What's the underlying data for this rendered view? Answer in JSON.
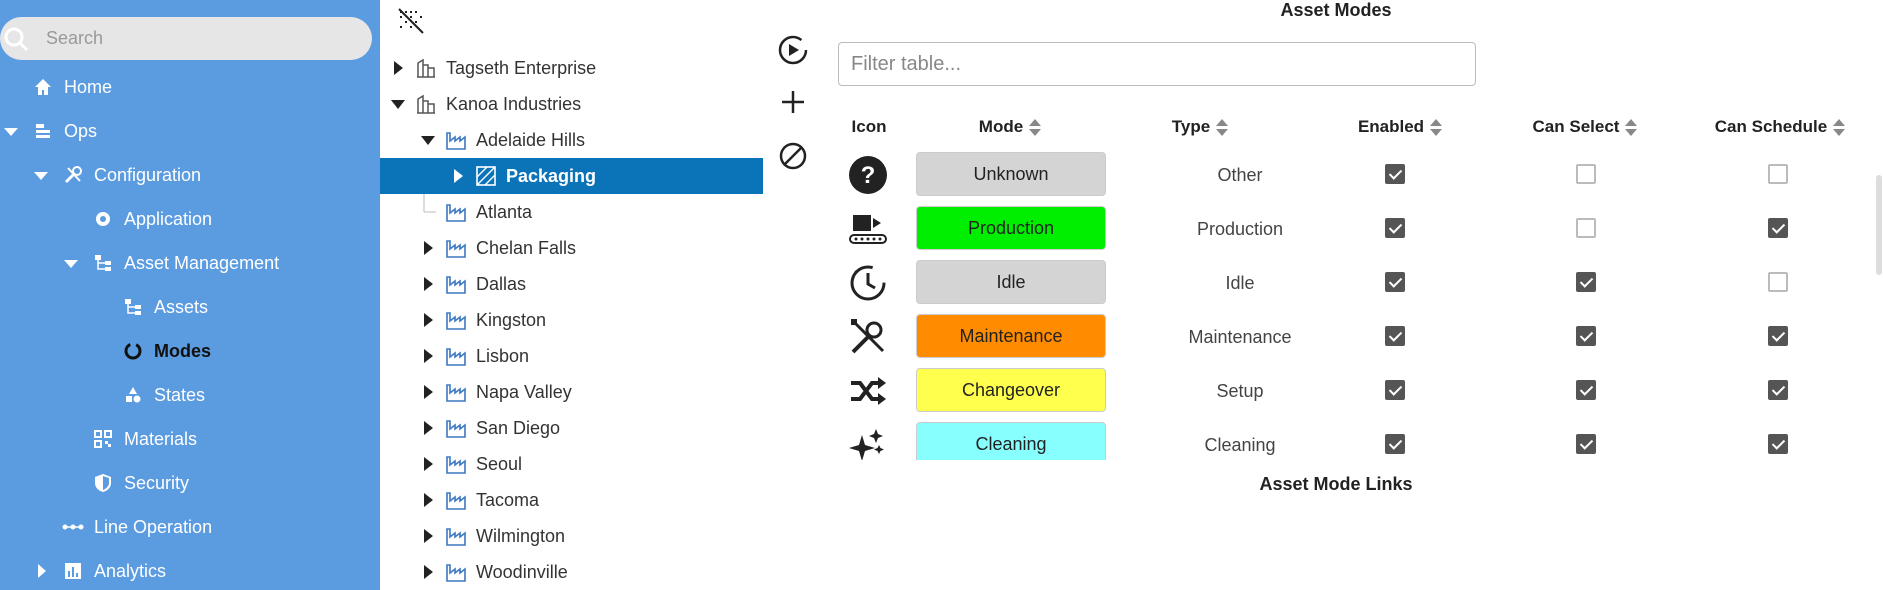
{
  "sidebar": {
    "search_placeholder": "Search",
    "items": [
      {
        "label": "Home",
        "icon": "home-icon"
      },
      {
        "label": "Ops",
        "icon": "ops-icon"
      },
      {
        "label": "Configuration",
        "icon": "tools-icon"
      },
      {
        "label": "Application",
        "icon": "gear-icon"
      },
      {
        "label": "Asset Management",
        "icon": "hierarchy-icon"
      },
      {
        "label": "Assets",
        "icon": "hierarchy-icon"
      },
      {
        "label": "Modes",
        "icon": "modes-icon"
      },
      {
        "label": "States",
        "icon": "states-icon"
      },
      {
        "label": "Materials",
        "icon": "qr-icon"
      },
      {
        "label": "Security",
        "icon": "shield-icon"
      },
      {
        "label": "Line Operation",
        "icon": "line-icon"
      },
      {
        "label": "Analytics",
        "icon": "chart-icon"
      }
    ]
  },
  "tree": {
    "items": [
      {
        "label": "Tagseth Enterprise"
      },
      {
        "label": "Kanoa Industries"
      },
      {
        "label": "Adelaide Hills"
      },
      {
        "label": "Packaging"
      },
      {
        "label": "Atlanta"
      },
      {
        "label": "Chelan Falls"
      },
      {
        "label": "Dallas"
      },
      {
        "label": "Kingston"
      },
      {
        "label": "Lisbon"
      },
      {
        "label": "Napa Valley"
      },
      {
        "label": "San Diego"
      },
      {
        "label": "Seoul"
      },
      {
        "label": "Tacoma"
      },
      {
        "label": "Wilmington"
      },
      {
        "label": "Woodinville"
      }
    ]
  },
  "main": {
    "title": "Asset Modes",
    "filter_placeholder": "Filter table...",
    "columns": [
      "Icon",
      "Mode",
      "Type",
      "Enabled",
      "Can Select",
      "Can Schedule"
    ],
    "rows": [
      {
        "icon": "question-icon",
        "mode": "Unknown",
        "color": "#d4d4d4",
        "type": "Other",
        "enabled": true,
        "can_select": false,
        "can_schedule": false
      },
      {
        "icon": "conveyor-icon",
        "mode": "Production",
        "color": "#00ee00",
        "type": "Production",
        "enabled": true,
        "can_select": false,
        "can_schedule": true
      },
      {
        "icon": "timer-icon",
        "mode": "Idle",
        "color": "#d4d4d4",
        "type": "Idle",
        "enabled": true,
        "can_select": true,
        "can_schedule": false
      },
      {
        "icon": "wrench-icon",
        "mode": "Maintenance",
        "color": "#ff8c00",
        "type": "Maintenance",
        "enabled": true,
        "can_select": true,
        "can_schedule": true
      },
      {
        "icon": "shuffle-icon",
        "mode": "Changeover",
        "color": "#ffff4d",
        "type": "Setup",
        "enabled": true,
        "can_select": true,
        "can_schedule": true
      },
      {
        "icon": "sparkle-icon",
        "mode": "Cleaning",
        "color": "#88ffff",
        "type": "Cleaning",
        "enabled": true,
        "can_select": true,
        "can_schedule": true
      }
    ],
    "links_title": "Asset Mode Links"
  },
  "colors": {
    "sidebar": "#5b9be0",
    "selected": "#0b74b8",
    "tree_icon": "#3a78c2"
  }
}
